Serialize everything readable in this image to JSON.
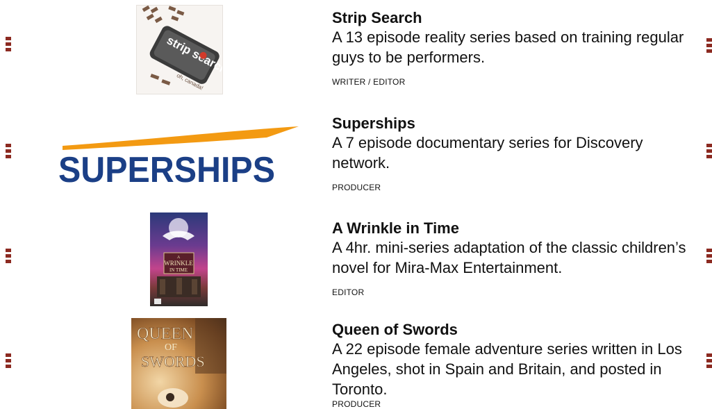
{
  "items": [
    {
      "title": "Strip Search",
      "description": "A 13 episode reality series based on training regular guys to be performers.",
      "role": "WRITER / EDITOR",
      "thumbnail": {
        "text_main": "strip search",
        "text_sub": "oh, canada!"
      }
    },
    {
      "title": "Superships",
      "description": "A 7 episode documentary series for Discovery network.",
      "role": "PRODUCER",
      "thumbnail": {
        "logo_text": "SUPERSHIPS",
        "logo_color": "#1b3f86",
        "swoosh_color": "#f39a12"
      }
    },
    {
      "title": "A Wrinkle in Time",
      "description": "A 4hr. mini-series adaptation of the classic children’s novel for Mira-Max Entertainment.",
      "role": "EDITOR",
      "thumbnail": {
        "line1": "A",
        "line2": "WRINKLE",
        "line3": "IN TIME"
      }
    },
    {
      "title": "Queen of Swords",
      "description": "A 22 episode female adventure series written in Los Angeles, shot in Spain and Britain, and posted in Toronto.",
      "role": "PRODUCER",
      "thumbnail": {
        "line1": "QUEEN",
        "line2": "OF",
        "line3": "SWORDS"
      }
    }
  ],
  "colors": {
    "accent_dots": "#8c2a21",
    "text": "#111111"
  }
}
